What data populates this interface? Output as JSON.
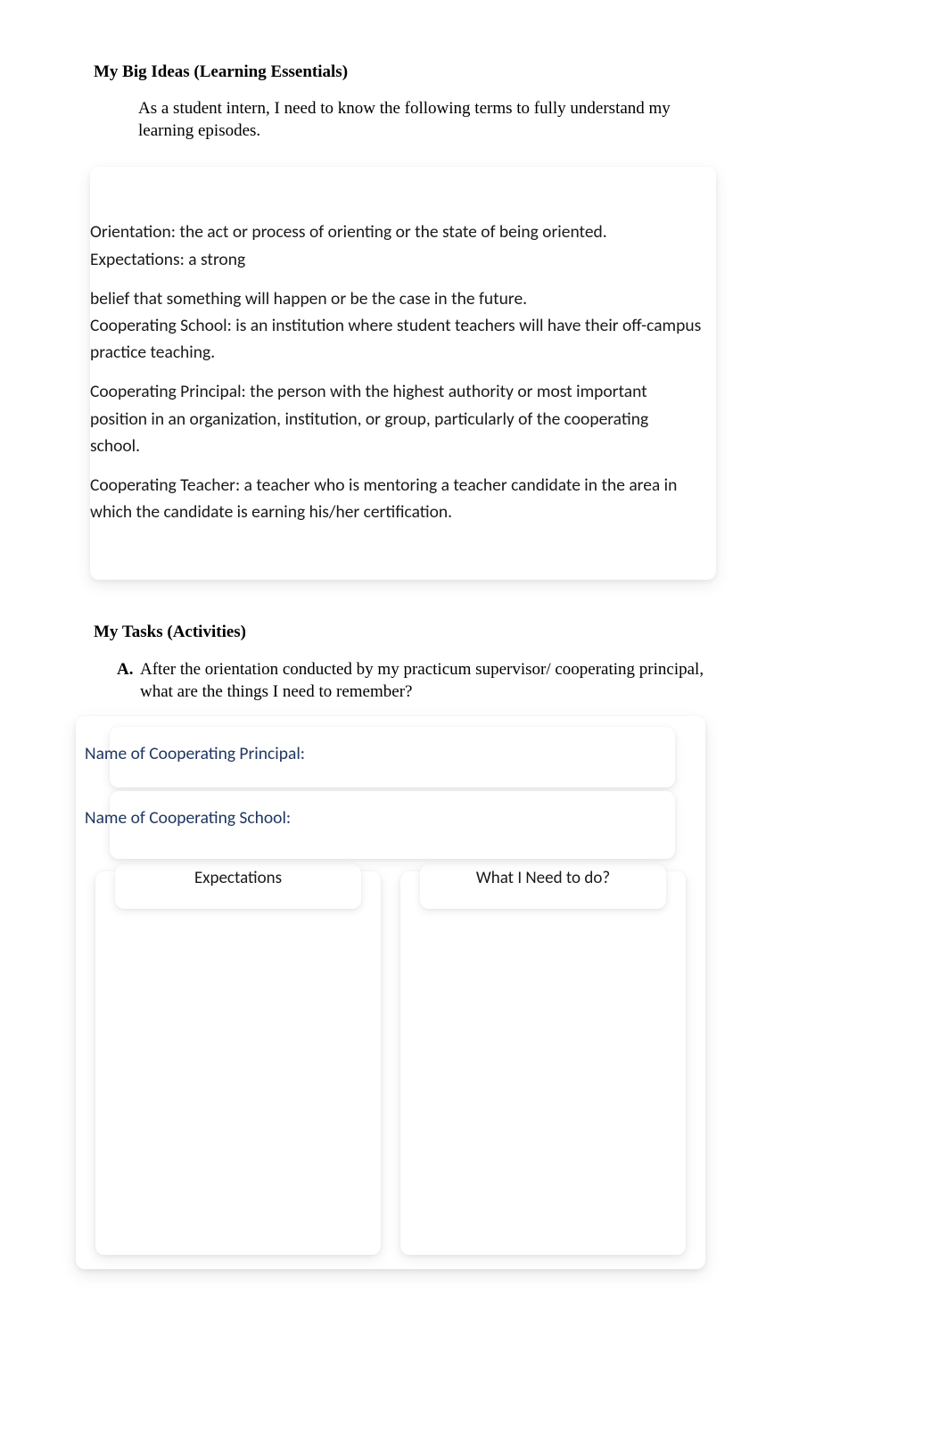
{
  "bigIdeas": {
    "heading": "My Big Ideas (Learning Essentials)",
    "intro": "As a student intern, I need to know the following terms to fully understand my learning episodes.",
    "definitions": [
      "Orientation: the act or process of orienting or the state of being oriented. Expectations: a strong",
      "belief that something will happen or be the case in the future.\nCooperating School: is an institution where student teachers will have their off-campus practice teaching.",
      "Cooperating Principal: the person with the highest authority or most important position in an organization, institution, or group, particularly of the cooperating school.",
      "Cooperating Teacher: a teacher who is mentoring a teacher candidate in the area in which the candidate is earning his/her certification."
    ]
  },
  "tasks": {
    "heading": "My Tasks (Activities)",
    "itemA": {
      "marker": "A.",
      "text": "After the orientation conducted by my practicum supervisor/ cooperating principal, what are the things I need to remember?"
    }
  },
  "worksheet": {
    "principalLabel": "Name of Cooperating Principal:",
    "schoolLabel": "Name of Cooperating School:",
    "columns": {
      "left": "Expectations",
      "right": "What I Need to do?"
    }
  }
}
